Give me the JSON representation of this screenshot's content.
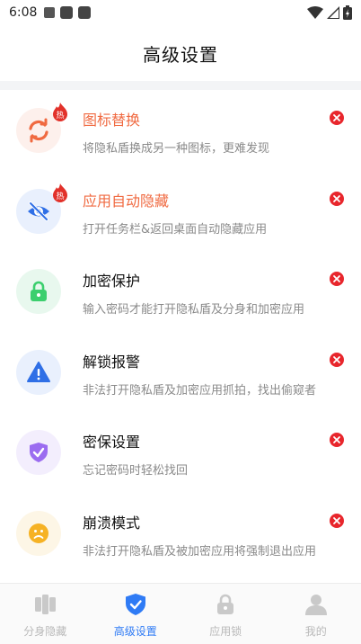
{
  "status_bar": {
    "time": "6:08"
  },
  "header": {
    "title": "高级设置"
  },
  "hot_badge_text": "热",
  "colors": {
    "accent": "#f06a41",
    "close": "#e8262c",
    "nav_active": "#2f7bf5",
    "nav_inactive": "#b9b9b9"
  },
  "features": [
    {
      "title": "图标替换",
      "desc": "将隐私盾换成另一种图标，更难发现",
      "icon": "refresh-icon",
      "hot": true
    },
    {
      "title": "应用自动隐藏",
      "desc": "打开任务栏&返回桌面自动隐藏应用",
      "icon": "eye-off-icon",
      "hot": true
    },
    {
      "title": "加密保护",
      "desc": "输入密码才能打开隐私盾及分身和加密应用",
      "icon": "lock-icon",
      "hot": false
    },
    {
      "title": "解锁报警",
      "desc": "非法打开隐私盾及加密应用抓拍，找出偷窥者",
      "icon": "warning-icon",
      "hot": false
    },
    {
      "title": "密保设置",
      "desc": "忘记密码时轻松找回",
      "icon": "shield-check-icon",
      "hot": false
    },
    {
      "title": "崩溃模式",
      "desc": "非法打开隐私盾及被加密应用将强制退出应用",
      "icon": "sad-face-icon",
      "hot": false
    }
  ],
  "nav": [
    {
      "label": "分身隐藏",
      "icon": "clone-icon",
      "active": false
    },
    {
      "label": "高级设置",
      "icon": "shield-icon",
      "active": true
    },
    {
      "label": "应用锁",
      "icon": "app-lock-icon",
      "active": false
    },
    {
      "label": "我的",
      "icon": "user-icon",
      "active": false
    }
  ]
}
